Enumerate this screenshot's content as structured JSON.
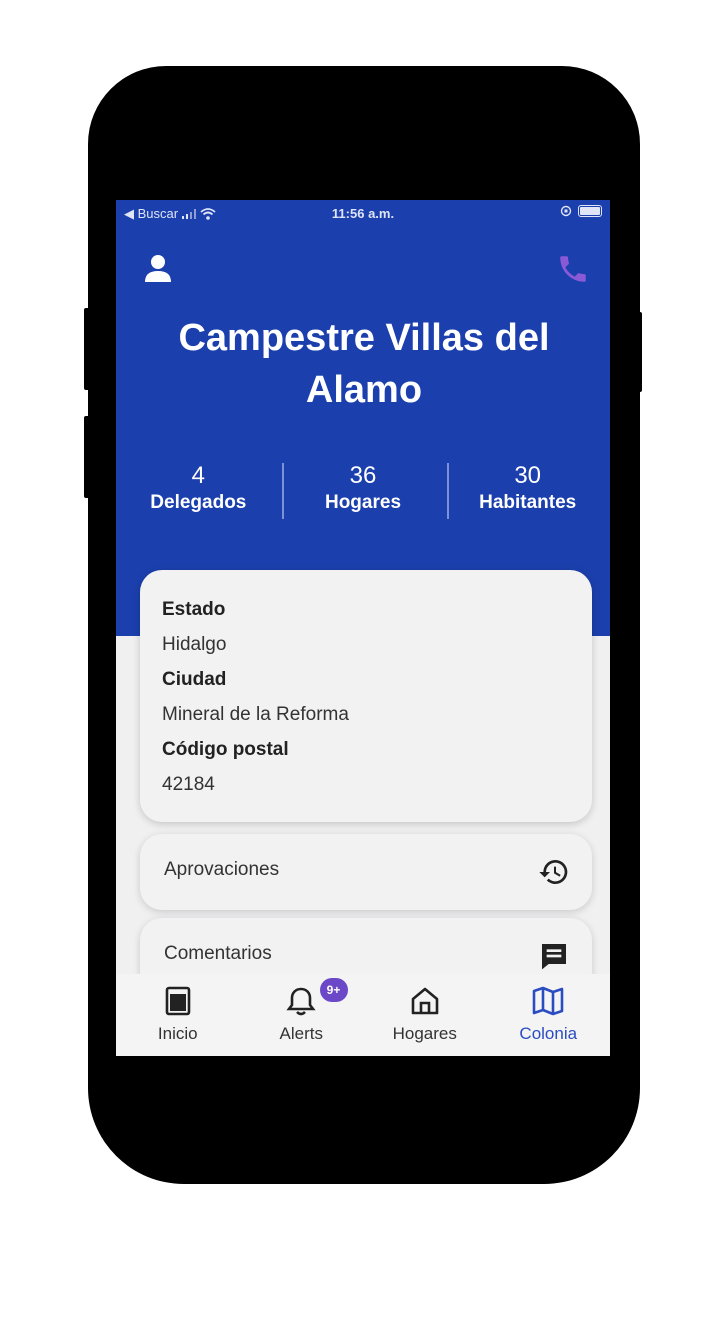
{
  "status_bar": {
    "back_label": "◀ Buscar",
    "time": "11:56 a.m."
  },
  "header": {
    "title": "Campestre Villas del Alamo"
  },
  "stats": [
    {
      "value": "4",
      "label": "Delegados"
    },
    {
      "value": "36",
      "label": "Hogares"
    },
    {
      "value": "30",
      "label": "Habitantes"
    }
  ],
  "info": {
    "estado_label": "Estado",
    "estado_value": "Hidalgo",
    "ciudad_label": "Ciudad",
    "ciudad_value": "Mineral de la Reforma",
    "cp_label": "Código postal",
    "cp_value": "42184"
  },
  "rows": [
    {
      "label": "Aprovaciones",
      "icon": "history-icon"
    },
    {
      "label": "Comentarios",
      "icon": "comments-icon"
    }
  ],
  "tabs": [
    {
      "label": "Inicio",
      "icon": "home-panel-icon"
    },
    {
      "label": "Alerts",
      "icon": "bell-icon",
      "badge": "9+"
    },
    {
      "label": "Hogares",
      "icon": "house-icon"
    },
    {
      "label": "Colonia",
      "icon": "map-icon",
      "active": true
    }
  ],
  "colors": {
    "primary": "#1b3fad",
    "accent_phone": "#8a5ad6",
    "badge": "#6b48c8",
    "active_tab": "#2a4cc0"
  }
}
